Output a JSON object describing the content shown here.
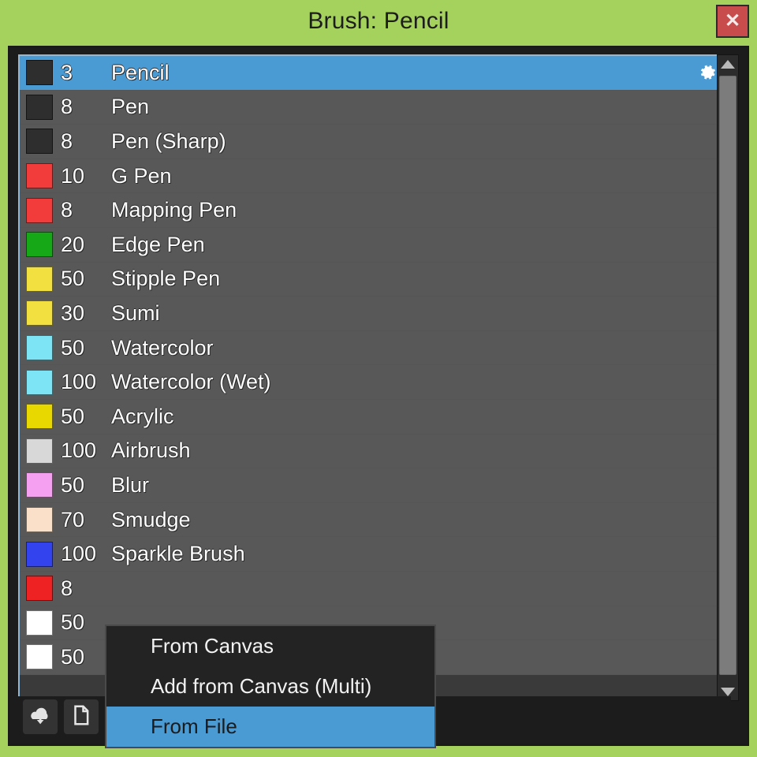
{
  "window": {
    "title": "Brush: Pencil",
    "close_label": "✕",
    "bg_color": "#a5d25c",
    "panel_color": "#1c1c1c",
    "accent_color": "#4a9ad4",
    "close_color": "#c94c4c"
  },
  "brush_list": {
    "rows": [
      {
        "color": "#2e2e2e",
        "size": "3",
        "name": "Pencil",
        "selected": true,
        "gear": "gear-icon"
      },
      {
        "color": "#2e2e2e",
        "size": "8",
        "name": "Pen",
        "selected": false
      },
      {
        "color": "#2e2e2e",
        "size": "8",
        "name": "Pen (Sharp)",
        "selected": false
      },
      {
        "color": "#f23b3b",
        "size": "10",
        "name": "G Pen",
        "selected": false
      },
      {
        "color": "#f23b3b",
        "size": "8",
        "name": "Mapping Pen",
        "selected": false
      },
      {
        "color": "#16a816",
        "size": "20",
        "name": "Edge Pen",
        "selected": false
      },
      {
        "color": "#f2e040",
        "size": "50",
        "name": "Stipple Pen",
        "selected": false
      },
      {
        "color": "#f2e040",
        "size": "30",
        "name": "Sumi",
        "selected": false
      },
      {
        "color": "#7de4f5",
        "size": "50",
        "name": "Watercolor",
        "selected": false
      },
      {
        "color": "#7de4f5",
        "size": "100",
        "name": "Watercolor (Wet)",
        "selected": false
      },
      {
        "color": "#e8d800",
        "size": "50",
        "name": "Acrylic",
        "selected": false
      },
      {
        "color": "#d8d8d8",
        "size": "100",
        "name": "Airbrush",
        "selected": false
      },
      {
        "color": "#f5a0f0",
        "size": "50",
        "name": "Blur",
        "selected": false
      },
      {
        "color": "#fae0c8",
        "size": "70",
        "name": "Smudge",
        "selected": false
      },
      {
        "color": "#3344ee",
        "size": "100",
        "name": "Sparkle Brush",
        "selected": false
      },
      {
        "color": "#ee2222",
        "size": "8",
        "name": "",
        "selected": false
      },
      {
        "color": "#ffffff",
        "size": "50",
        "name": "",
        "selected": false
      },
      {
        "color": "#ffffff",
        "size": "50",
        "name": "",
        "selected": false
      }
    ]
  },
  "scrollbar": {
    "up_arrow": "arrow-up-icon",
    "down_arrow": "arrow-down-icon",
    "thumb": "scrollbar-thumb"
  },
  "toolbar": {
    "buttons": [
      {
        "icon": "cloud-download-icon",
        "active": false,
        "caret": false
      },
      {
        "icon": "new-file-icon",
        "active": false,
        "caret": false
      },
      {
        "icon": "add-image-icon",
        "active": true,
        "caret": true
      },
      {
        "icon": "script-file-icon",
        "active": false,
        "caret": false
      },
      {
        "icon": "folder-icon",
        "active": false,
        "caret": false
      },
      {
        "icon": "duplicate-icon",
        "active": false,
        "caret": false
      },
      {
        "icon": "separator",
        "active": false,
        "caret": false
      },
      {
        "icon": "trash-icon",
        "active": false,
        "caret": false
      }
    ]
  },
  "context_menu": {
    "items": [
      {
        "label": "From Canvas",
        "highlight": false
      },
      {
        "label": "Add from Canvas (Multi)",
        "highlight": false
      },
      {
        "label": "From File",
        "highlight": true
      }
    ]
  }
}
